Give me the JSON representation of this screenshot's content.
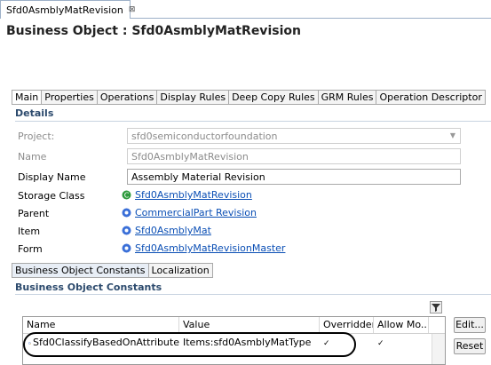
{
  "editor_tab": {
    "label": "Sfd0AsmblyMatRevision",
    "close": "⊠"
  },
  "page_title": "Business Object : Sfd0AsmblyMatRevision",
  "tabs": [
    "Main",
    "Properties",
    "Operations",
    "Display Rules",
    "Deep Copy Rules",
    "GRM Rules",
    "Operation Descriptor"
  ],
  "details": {
    "header": "Details",
    "project": {
      "label": "Project:",
      "value": "sfd0semiconductorfoundation"
    },
    "name": {
      "label": "Name",
      "value": "Sfd0AsmblyMatRevision"
    },
    "display_name": {
      "label": "Display Name",
      "value": "Assembly Material Revision"
    },
    "storage_class": {
      "label": "Storage Class",
      "value": "Sfd0AsmblyMatRevision"
    },
    "parent": {
      "label": "Parent",
      "value": "CommercialPart Revision"
    },
    "item": {
      "label": "Item",
      "value": "Sfd0AsmblyMat"
    },
    "form": {
      "label": "Form",
      "value": "Sfd0AsmblyMatRevisionMaster"
    }
  },
  "sub_tabs": [
    "Business Object Constants",
    "Localization"
  ],
  "constants": {
    "header": "Business Object Constants",
    "columns": [
      "Name",
      "Value",
      "Overridden",
      "Allow Mo..."
    ],
    "rows": [
      {
        "name": "Sfd0ClassifyBasedOnAttribute",
        "value": "Items:sfd0AsmblyMatType",
        "overridden": "✓",
        "allow": "✓"
      }
    ],
    "edit_label": "Edit...",
    "reset_label": "Reset"
  },
  "colors": {
    "link": "#0b4fb5",
    "section_header": "#2c4a6d",
    "highlight": "#000000"
  }
}
